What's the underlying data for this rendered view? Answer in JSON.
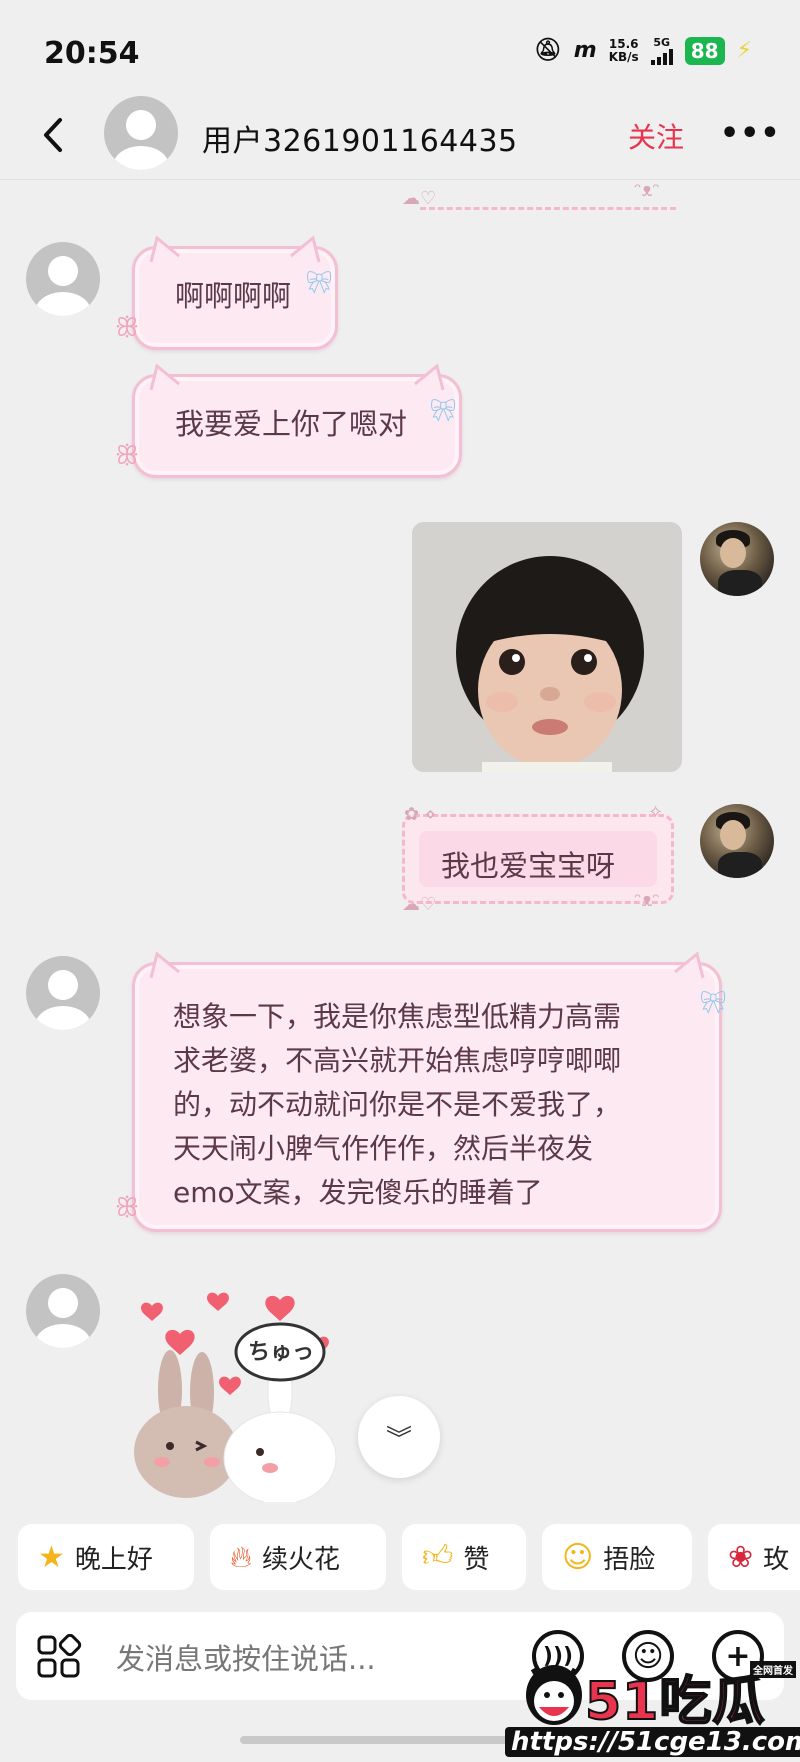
{
  "status_bar": {
    "time": "20:54",
    "net_speed_value": "15.6",
    "net_speed_unit": "KB/s",
    "network": "5G",
    "battery": "88"
  },
  "header": {
    "username": "用户3261901164435",
    "follow_label": "关注",
    "more_label": "•••"
  },
  "messages": [
    {
      "side": "left",
      "type": "text",
      "text": "啊啊啊啊"
    },
    {
      "side": "left",
      "type": "text",
      "text": "我要爱上你了嗯对"
    },
    {
      "side": "right",
      "type": "image"
    },
    {
      "side": "right",
      "type": "text",
      "text": "我也爱宝宝呀"
    },
    {
      "side": "left",
      "type": "text",
      "lines": [
        "想象一下，我是你焦虑型低精力高需",
        "求老婆，不高兴就开始焦虑哼哼唧唧",
        "的，动不动就问你是不是不爱我了，",
        "天天闹小脾气作作作，然后半夜发",
        "emo文案，发完傻乐的睡着了"
      ]
    },
    {
      "side": "left",
      "type": "sticker",
      "text": "ちゅっ"
    }
  ],
  "quick_replies": [
    {
      "label": "晚上好",
      "icon": "star-face-icon"
    },
    {
      "label": "续火花",
      "icon": "fire-icon"
    },
    {
      "label": "赞",
      "icon": "thumbs-up-icon"
    },
    {
      "label": "捂脸",
      "icon": "facepalm-icon"
    },
    {
      "label": "玫",
      "icon": "rose-icon"
    }
  ],
  "input": {
    "placeholder": "发消息或按住说话..."
  },
  "watermark": {
    "logo": "51吃瓜",
    "tag": "全网首发",
    "url": "https://51cge13.com"
  },
  "colors": {
    "follow": "#e8344f",
    "bubble_bg": "#fde9f1",
    "bubble_border": "#f3bfd3",
    "page_bg": "#efefef"
  }
}
